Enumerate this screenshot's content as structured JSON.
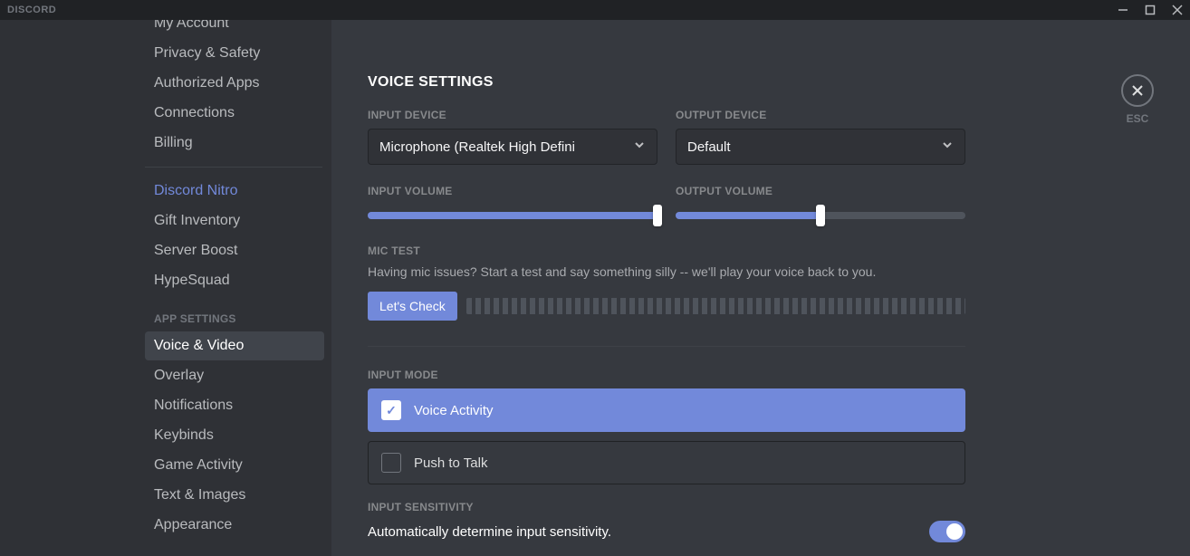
{
  "app_name": "DISCORD",
  "close_label": "ESC",
  "sidebar": {
    "user_settings": [
      {
        "label": "My Account"
      },
      {
        "label": "Privacy & Safety"
      },
      {
        "label": "Authorized Apps"
      },
      {
        "label": "Connections"
      },
      {
        "label": "Billing"
      }
    ],
    "nitro_items": [
      {
        "label": "Discord Nitro",
        "nitro": true
      },
      {
        "label": "Gift Inventory"
      },
      {
        "label": "Server Boost"
      },
      {
        "label": "HypeSquad"
      }
    ],
    "app_header": "APP SETTINGS",
    "app_items": [
      {
        "label": "Voice & Video",
        "active": true
      },
      {
        "label": "Overlay"
      },
      {
        "label": "Notifications"
      },
      {
        "label": "Keybinds"
      },
      {
        "label": "Game Activity"
      },
      {
        "label": "Text & Images"
      },
      {
        "label": "Appearance"
      }
    ]
  },
  "voice": {
    "title": "VOICE SETTINGS",
    "input_device_label": "INPUT DEVICE",
    "input_device_value": "Microphone (Realtek High Defini",
    "output_device_label": "OUTPUT DEVICE",
    "output_device_value": "Default",
    "input_volume_label": "INPUT VOLUME",
    "input_volume_pct": 100,
    "output_volume_label": "OUTPUT VOLUME",
    "output_volume_pct": 50,
    "mic_test_label": "MIC TEST",
    "mic_test_desc": "Having mic issues? Start a test and say something silly -- we'll play your voice back to you.",
    "mic_test_btn": "Let's Check",
    "input_mode_label": "INPUT MODE",
    "mode_voice_activity": "Voice Activity",
    "mode_push_to_talk": "Push to Talk",
    "input_sensitivity_label": "INPUT SENSITIVITY",
    "auto_sensitivity": "Automatically determine input sensitivity."
  }
}
